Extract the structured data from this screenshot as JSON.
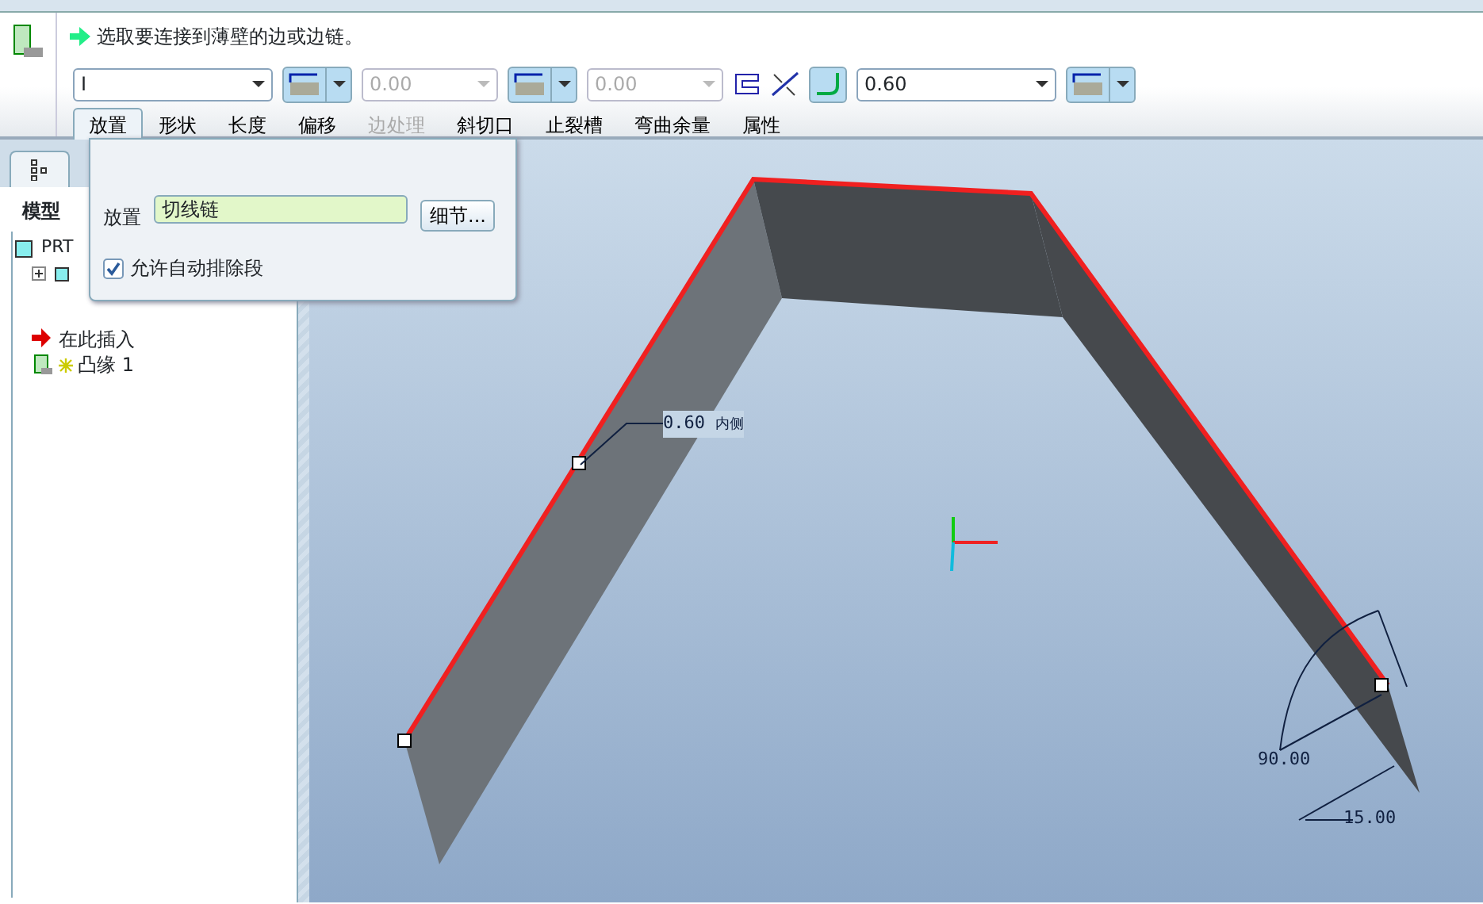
{
  "message": "选取要连接到薄壁的边或边链。",
  "controls": [
    {
      "kind": "combo",
      "value": "I",
      "disabled": false
    },
    {
      "kind": "split"
    },
    {
      "kind": "combo",
      "value": "0.00",
      "disabled": true
    },
    {
      "kind": "split"
    },
    {
      "kind": "combo",
      "value": "0.00",
      "disabled": true
    },
    {
      "kind": "icon"
    },
    {
      "kind": "icon"
    },
    {
      "kind": "toggle"
    },
    {
      "kind": "combo",
      "value": "0.60",
      "disabled": false
    },
    {
      "kind": "split"
    }
  ],
  "tabs": [
    {
      "label": "放置",
      "selected": true,
      "disabled": false
    },
    {
      "label": "形状",
      "selected": false,
      "disabled": false
    },
    {
      "label": "长度",
      "selected": false,
      "disabled": false
    },
    {
      "label": "偏移",
      "selected": false,
      "disabled": false
    },
    {
      "label": "边处理",
      "selected": false,
      "disabled": true
    },
    {
      "label": "斜切口",
      "selected": false,
      "disabled": false
    },
    {
      "label": "止裂槽",
      "selected": false,
      "disabled": false
    },
    {
      "label": "弯曲余量",
      "selected": false,
      "disabled": false
    },
    {
      "label": "属性",
      "selected": false,
      "disabled": false
    }
  ],
  "placement_panel": {
    "label": "放置",
    "field_value": "切线链",
    "details_button": "细节...",
    "auto_exclude": {
      "label": "允许自动排除段",
      "checked": true
    }
  },
  "model_tree": {
    "title": "模型",
    "items": [
      {
        "kind": "part",
        "label": "PRT"
      },
      {
        "kind": "folder",
        "expandable": true
      },
      {
        "kind": "insert",
        "label": "在此插入"
      },
      {
        "kind": "feature",
        "label": "凸缘 1"
      }
    ]
  },
  "viewport": {
    "annotations": [
      {
        "kind": "thickness",
        "text": "0.60",
        "note": "内侧"
      },
      {
        "kind": "angle",
        "text": "90.00"
      },
      {
        "kind": "length",
        "text": "15.00"
      }
    ]
  }
}
